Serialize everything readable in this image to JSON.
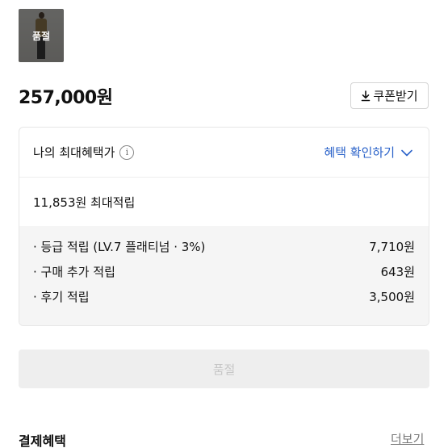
{
  "product": {
    "thumbnail_badge": "품절",
    "price": "257,000원"
  },
  "coupon": {
    "label": "쿠폰받기",
    "icon": "download-icon"
  },
  "benefit": {
    "title": "나의 최대혜택가",
    "info_icon": "info-icon",
    "check_link": "혜택 확인하기",
    "summary": "11,853원 최대적립",
    "rows": [
      {
        "label": "· 등급 적립 (LV.7 플래티넘 · 3%)",
        "value": "7,710원"
      },
      {
        "label": "· 구매 추가 적립",
        "value": "643원"
      },
      {
        "label": "· 후기 적립",
        "value": "3,500원"
      }
    ]
  },
  "action": {
    "soldout_label": "품절"
  },
  "payment": {
    "title": "결제혜택",
    "more_label": "더보기"
  },
  "colors": {
    "accent": "#2a62c9",
    "disabled_bg": "#eeeeee",
    "disabled_text": "#c6c6c6"
  }
}
